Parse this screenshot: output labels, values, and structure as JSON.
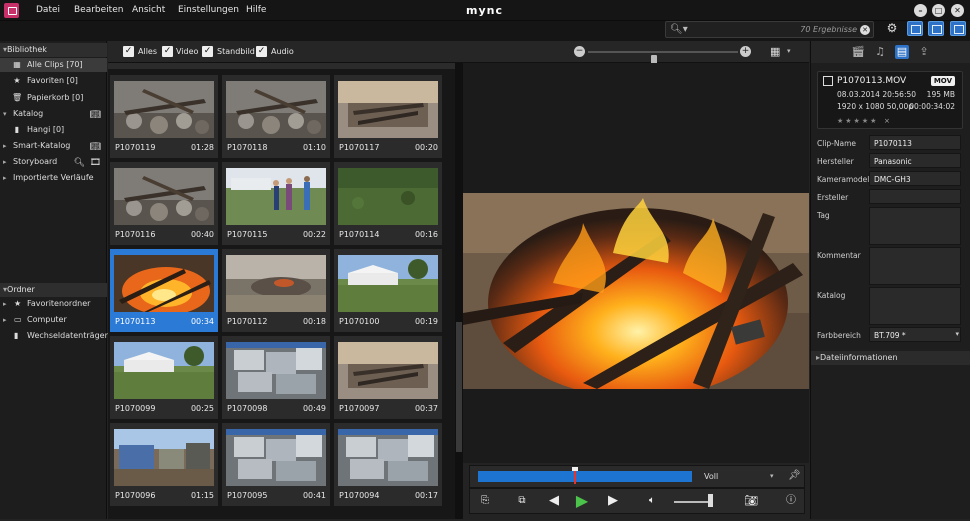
{
  "app": {
    "brand": "mync"
  },
  "menu": [
    "Datei",
    "Bearbeiten",
    "Ansicht",
    "Einstellungen",
    "Hilfe"
  ],
  "search": {
    "results": "70 Ergebnisse"
  },
  "sidebar": {
    "library_header": "Bibliothek",
    "library_items": [
      {
        "label": "Alle Clips [70]",
        "icon": "film-icon",
        "selected": true
      },
      {
        "label": "Favoriten [0]",
        "icon": "star-icon"
      },
      {
        "label": "Papierkorb [0]",
        "icon": "trash-icon"
      }
    ],
    "katalog": {
      "label": "Katalog",
      "items": [
        {
          "label": "Hangi [0]",
          "icon": "book-icon"
        }
      ]
    },
    "smart_katalog": {
      "label": "Smart-Katalog"
    },
    "storyboard": {
      "label": "Storyboard"
    },
    "import_history": {
      "label": "Importierte Verläufe"
    },
    "ordner_header": "Ordner",
    "ordner_items": [
      {
        "label": "Favoritenordner",
        "icon": "star-icon"
      },
      {
        "label": "Computer",
        "icon": "monitor-icon"
      },
      {
        "label": "Wechseldatenträger",
        "icon": "drive-icon"
      }
    ]
  },
  "filters": {
    "all": "Alles",
    "video": "Video",
    "still": "Standbild",
    "audio": "Audio",
    "zoom_level": 0.42
  },
  "clips": [
    {
      "name": "P1070119",
      "duration": "01:28",
      "scene": "stones"
    },
    {
      "name": "P1070118",
      "duration": "01:10",
      "scene": "stones"
    },
    {
      "name": "P1070117",
      "duration": "00:20",
      "scene": "grill"
    },
    {
      "name": "P1070116",
      "duration": "00:40",
      "scene": "stones"
    },
    {
      "name": "P1070115",
      "duration": "00:22",
      "scene": "people"
    },
    {
      "name": "P1070114",
      "duration": "00:16",
      "scene": "grass"
    },
    {
      "name": "P1070113",
      "duration": "00:34",
      "scene": "fire",
      "selected": true
    },
    {
      "name": "P1070112",
      "duration": "00:18",
      "scene": "smoke"
    },
    {
      "name": "P1070100",
      "duration": "00:19",
      "scene": "tents"
    },
    {
      "name": "P1070099",
      "duration": "00:25",
      "scene": "tents"
    },
    {
      "name": "P1070098",
      "duration": "00:49",
      "scene": "foil"
    },
    {
      "name": "P1070097",
      "duration": "00:37",
      "scene": "grill"
    },
    {
      "name": "P1070096",
      "duration": "01:15",
      "scene": "camp"
    },
    {
      "name": "P1070095",
      "duration": "00:41",
      "scene": "foil"
    },
    {
      "name": "P1070094",
      "duration": "00:17",
      "scene": "foil"
    }
  ],
  "timeline": {
    "mode": "Voll",
    "progress": 0.45
  },
  "transport": {
    "volume": 0.95
  },
  "inspector": {
    "file": {
      "name": "P1070113.MOV",
      "format": "MOV",
      "date": "08.03.2014 20:56:50",
      "size": "195 MB",
      "resolution": "1920 x 1080 50,00p",
      "duration": "00:00:34:02",
      "rating_stars": "★★★★★",
      "rating_clear": "×"
    },
    "fields": [
      {
        "label": "Clip-Name",
        "value": "P1070113",
        "tall": false
      },
      {
        "label": "Hersteller",
        "value": "Panasonic",
        "tall": false
      },
      {
        "label": "Kameramodell",
        "value": "DMC-GH3",
        "tall": false
      },
      {
        "label": "Ersteller",
        "value": "",
        "tall": false
      },
      {
        "label": "Tag",
        "value": "",
        "tall": true
      },
      {
        "label": "Kommentar",
        "value": "",
        "tall": true
      },
      {
        "label": "Katalog",
        "value": "",
        "tall": true
      },
      {
        "label": "Farbbereich",
        "value": "BT.709 *",
        "tall": false
      }
    ],
    "date_info": "Dateiinformationen"
  }
}
